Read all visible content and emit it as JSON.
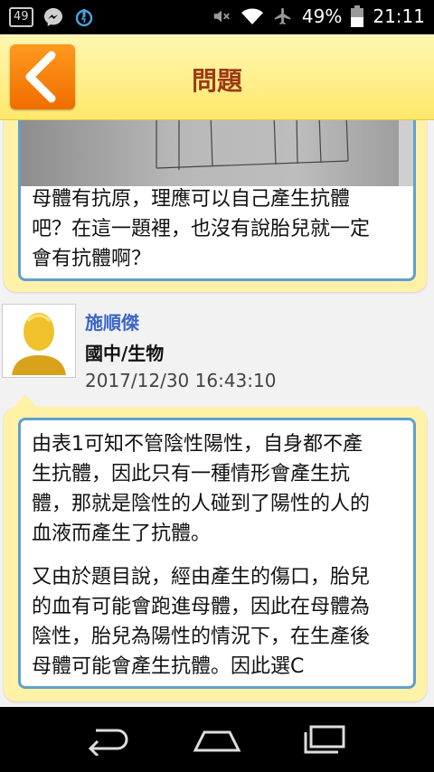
{
  "status_bar": {
    "notification_count": "49",
    "battery_percent": "49%",
    "time": "21:11",
    "icons": [
      "notification-49-icon",
      "messenger-icon",
      "power-app-icon",
      "mute-icon",
      "wifi-icon",
      "airplane-icon",
      "battery-icon"
    ]
  },
  "header": {
    "title": "問題",
    "back_icon": "chevron-left-icon"
  },
  "question": {
    "text_lines": [
      "母體有抗原，理應可以自己產生抗體",
      "吧？在這一題裡，也沒有說胎兒就一定",
      "會有抗體啊？"
    ]
  },
  "answer": {
    "author": "施順傑",
    "subject": "國中/生物",
    "timestamp": "2017/12/30 16:43:10",
    "paragraph1_lines": [
      "由表1可知不管陰性陽性，自身都不產",
      "生抗體，因此只有一種情形會產生抗",
      "體，那就是陰性的人碰到了陽性的人的",
      "血液而產生了抗體。"
    ],
    "paragraph2_lines": [
      "又由於題目說，經由產生的傷口，胎兒",
      "的血有可能會跑進母體，因此在母體為",
      "陰性，胎兒為陽性的情況下，在生產後",
      "母體可能會產生抗體。因此選C"
    ]
  },
  "nav_bar": {
    "icons": [
      "back-nav-icon",
      "home-nav-icon",
      "recents-nav-icon"
    ]
  },
  "colors": {
    "header_bg": "#ffe86a",
    "title_text": "#9c3a14",
    "back_button": "#f27b00",
    "bubble_outer": "#fff2a6",
    "bubble_border": "#5fa0cf",
    "author_name": "#3b64c8"
  }
}
